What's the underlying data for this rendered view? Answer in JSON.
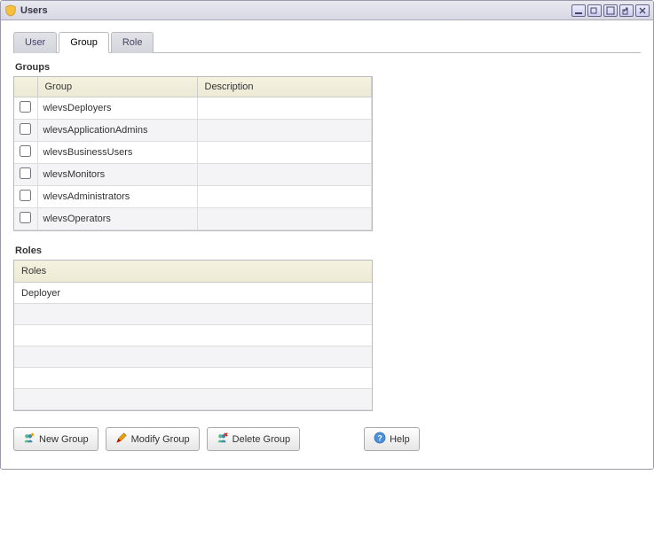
{
  "window": {
    "title": "Users"
  },
  "tabs": [
    {
      "label": "User"
    },
    {
      "label": "Group"
    },
    {
      "label": "Role"
    }
  ],
  "activeTab": 1,
  "groupsSection": {
    "heading": "Groups",
    "columns": {
      "check": "",
      "group": "Group",
      "description": "Description"
    },
    "rows": [
      {
        "group": "wlevsDeployers",
        "description": ""
      },
      {
        "group": "wlevsApplicationAdmins",
        "description": ""
      },
      {
        "group": "wlevsBusinessUsers",
        "description": ""
      },
      {
        "group": "wlevsMonitors",
        "description": ""
      },
      {
        "group": "wlevsAdministrators",
        "description": ""
      },
      {
        "group": "wlevsOperators",
        "description": ""
      }
    ]
  },
  "rolesSection": {
    "heading": "Roles",
    "column": "Roles",
    "rows": [
      "Deployer",
      "",
      "",
      "",
      "",
      ""
    ]
  },
  "buttons": {
    "newGroup": "New Group",
    "modifyGroup": "Modify Group",
    "deleteGroup": "Delete Group",
    "help": "Help"
  }
}
